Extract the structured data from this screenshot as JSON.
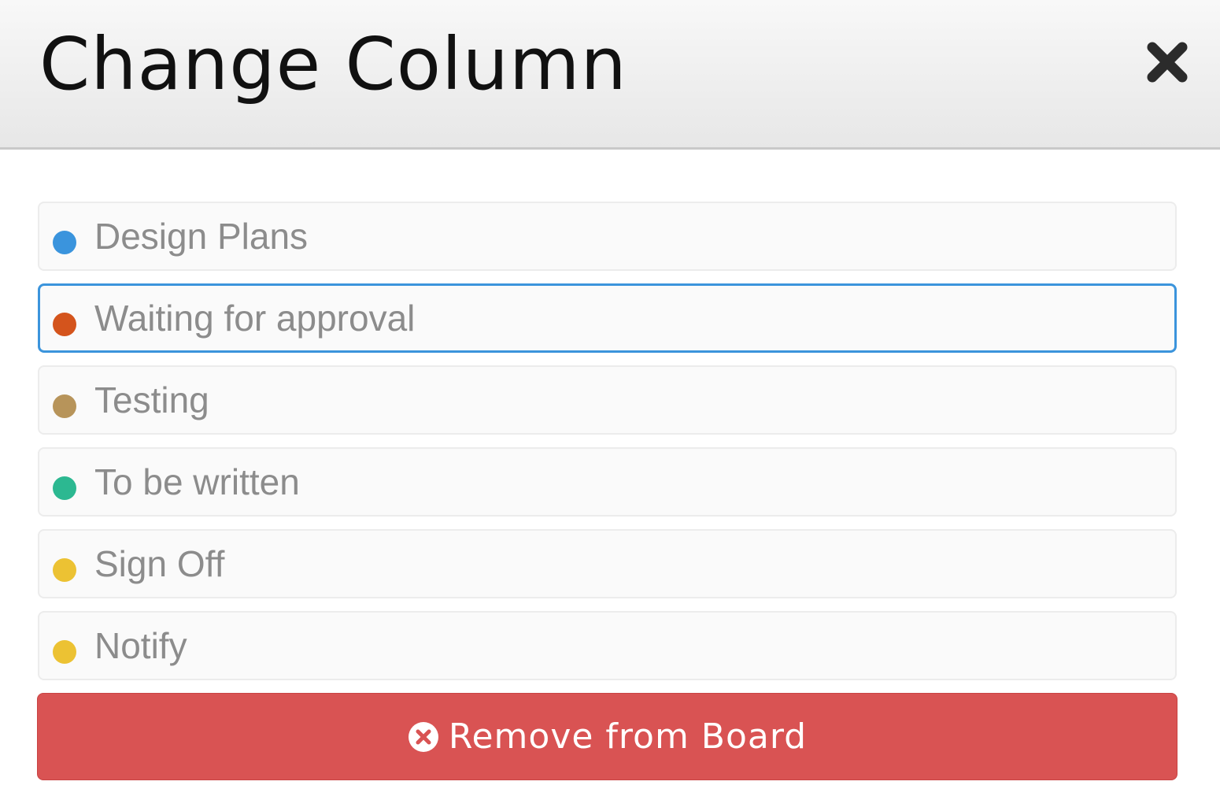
{
  "dialog": {
    "title": "Change Column",
    "close_icon": "close-icon"
  },
  "columns": [
    {
      "label": "Design Plans",
      "color": "#3a94dd",
      "selected": false
    },
    {
      "label": "Waiting for approval",
      "color": "#d4541c",
      "selected": true
    },
    {
      "label": "Testing",
      "color": "#b7945a",
      "selected": false
    },
    {
      "label": "To be written",
      "color": "#2cb891",
      "selected": false
    },
    {
      "label": "Sign Off",
      "color": "#ecc233",
      "selected": false
    },
    {
      "label": "Notify",
      "color": "#ecc233",
      "selected": false
    }
  ],
  "remove_button": {
    "label": "Remove from Board",
    "icon": "circle-x-icon",
    "color": "#d95353"
  },
  "colors": {
    "selected_border": "#3b94dc",
    "label_text": "#8c8c8c"
  }
}
